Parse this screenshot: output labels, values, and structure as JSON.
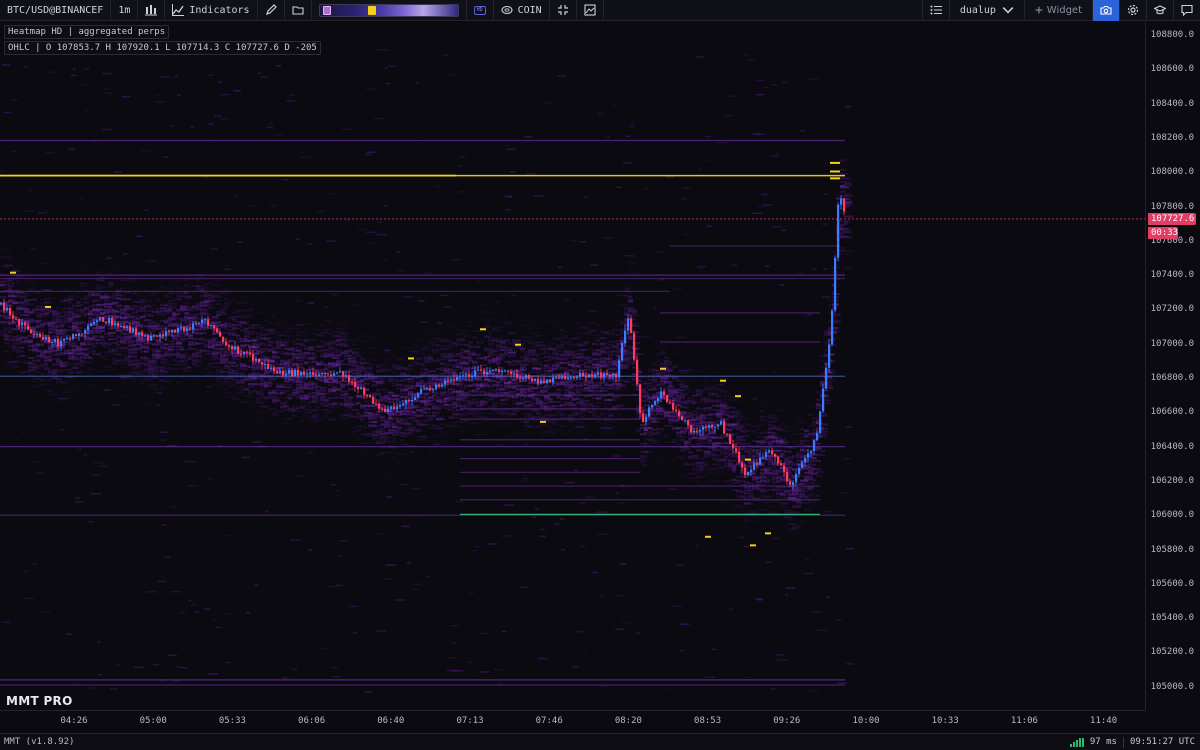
{
  "toolbar": {
    "symbol": "BTC/USD@BINANCEF",
    "timeframe": "1m",
    "chart_type_icon": "candles-icon",
    "indicators_label": "Indicators",
    "draw_icon": "pencil-icon",
    "folder_icon": "folder-icon",
    "hd_icon": "hd-icon",
    "coin_label": "COIN",
    "collapse_icon": "collapse-icon",
    "snapshot_icon": "image-icon",
    "list_icon": "list-icon",
    "layout_label": "dualup",
    "widget_label": "Widget",
    "camera_icon": "camera-icon",
    "settings_icon": "gear-icon",
    "academy_icon": "graduation-cap-icon",
    "chat_icon": "chat-icon",
    "gradient_handle_left_color": "#b06fd0",
    "gradient_handle_right_color": "#f2d21b"
  },
  "overlay": {
    "heatmap_label": "Heatmap HD | aggregated perps",
    "ohlc_label": "OHLC | O 107853.7 H 107920.1 L 107714.3 C 107727.6 D -205",
    "brand": "MMT PRO"
  },
  "price_axis": {
    "ticks": [
      "108800.0",
      "108600.0",
      "108400.0",
      "108200.0",
      "108000.0",
      "107800.0",
      "107600.0",
      "107400.0",
      "107200.0",
      "107000.0",
      "106800.0",
      "106600.0",
      "106400.0",
      "106200.0",
      "106000.0",
      "105800.0",
      "105600.0",
      "105400.0",
      "105200.0",
      "105000.0"
    ],
    "current_price": "107727.6",
    "countdown": "00:33",
    "tag_color": "#e23d66"
  },
  "time_axis": {
    "ticks": [
      "04:26",
      "05:00",
      "05:33",
      "06:06",
      "06:40",
      "07:13",
      "07:46",
      "08:20",
      "08:53",
      "09:26",
      "10:00",
      "10:33",
      "11:06",
      "11:40"
    ]
  },
  "status": {
    "version": "MMT (v1.8.92)",
    "latency": "97 ms",
    "clock": "09:51:27 UTC"
  },
  "colors": {
    "bull": "#3d7bff",
    "bear": "#ff3d5a",
    "heat_low": "#3a1456",
    "heat_mid": "#7a2ea8",
    "heat_high": "#f2d21b",
    "price_line": "#e23d66"
  }
}
